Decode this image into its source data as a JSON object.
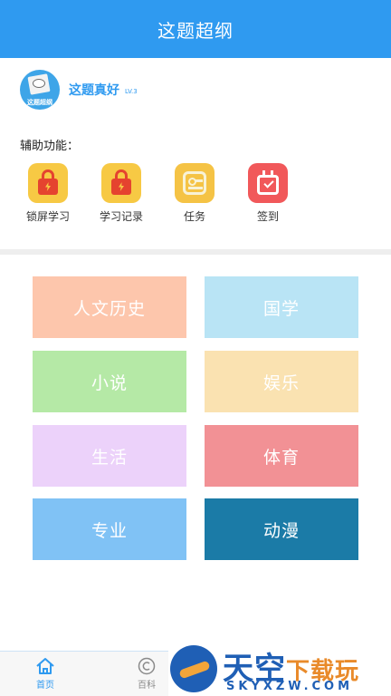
{
  "header": {
    "title": "这题超纲"
  },
  "profile": {
    "avatar_text": "这题超纲",
    "username": "这题真好",
    "level": "LV.3"
  },
  "assist": {
    "label": "辅助功能：",
    "tools": [
      {
        "label": "锁屏学习",
        "icon": "lock-icon",
        "bg": "#f7c944"
      },
      {
        "label": "学习记录",
        "icon": "lock-icon",
        "bg": "#f7c944"
      },
      {
        "label": "任务",
        "icon": "task-list-icon",
        "bg": "#f5c345"
      },
      {
        "label": "签到",
        "icon": "calendar-check-icon",
        "bg": "#f1585a"
      }
    ]
  },
  "categories": [
    {
      "label": "人文历史",
      "color": "#fdc6ac"
    },
    {
      "label": "国学",
      "color": "#b9e4f5"
    },
    {
      "label": "小说",
      "color": "#b5e9a6"
    },
    {
      "label": "娱乐",
      "color": "#fae2b1"
    },
    {
      "label": "生活",
      "color": "#ecd2fa"
    },
    {
      "label": "体育",
      "color": "#f29195"
    },
    {
      "label": "专业",
      "color": "#80c2f5"
    },
    {
      "label": "动漫",
      "color": "#1b7ba7"
    }
  ],
  "tabbar": {
    "tabs": [
      {
        "label": "首页",
        "icon": "home-icon",
        "active": true
      },
      {
        "label": "百科",
        "icon": "copyright-icon",
        "active": false
      }
    ]
  },
  "watermark": {
    "main": "天空",
    "accent": "下载玩",
    "sub": "SKYXZW.COM"
  },
  "colors": {
    "accent": "#2f9af0",
    "divider": "#eeeeee"
  }
}
